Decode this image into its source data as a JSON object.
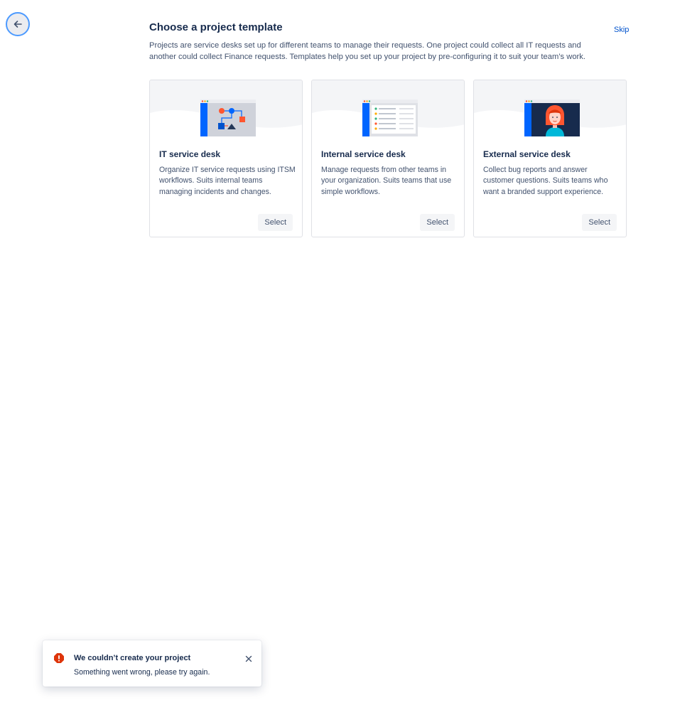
{
  "header": {
    "back_icon": "arrow-left-icon",
    "title": "Choose a project template",
    "skip_label": "Skip",
    "description": "Projects are service desks set up for different teams to manage their requests. One project could collect all IT requests and another could collect Finance requests. Templates help you set up your project by pre-configuring it to suit your team’s work."
  },
  "templates": [
    {
      "title": "IT service desk",
      "description": "Organize IT service requests using ITSM workflows. Suits internal teams managing incidents and changes.",
      "select_label": "Select",
      "illustration": "workflow-illustration"
    },
    {
      "title": "Internal service desk",
      "description": "Manage requests from other teams in your organization. Suits teams that use simple workflows.",
      "select_label": "Select",
      "illustration": "list-illustration"
    },
    {
      "title": "External service desk",
      "description": "Collect bug reports and answer customer questions. Suits teams who want a branded support experience.",
      "select_label": "Select",
      "illustration": "customer-portrait-illustration"
    }
  ],
  "toast": {
    "icon": "error-icon",
    "title": "We couldn’t create your project",
    "message": "Something went wrong, please try again.",
    "close_icon": "close-icon"
  },
  "colors": {
    "link": "#0052CC",
    "focus_ring": "#4C9AFF",
    "error": "#DE350B",
    "text_primary": "#172B4D",
    "text_secondary": "#42526E",
    "button_bg": "#F4F5F7"
  }
}
